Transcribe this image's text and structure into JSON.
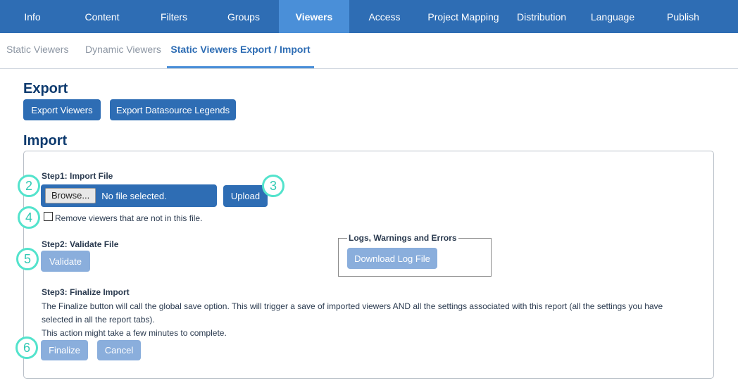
{
  "top_tabs": [
    "Info",
    "Content",
    "Filters",
    "Groups",
    "Viewers",
    "Access",
    "Project Mapping",
    "Distribution",
    "Language",
    "Publish"
  ],
  "active_top_tab": "Viewers",
  "sub_tabs": [
    "Static Viewers",
    "Dynamic Viewers",
    "Static Viewers Export / Import"
  ],
  "active_sub_tab": "Static Viewers Export / Import",
  "export": {
    "heading": "Export",
    "export_viewers_button": "Export Viewers",
    "export_legends_button": "Export Datasource Legends"
  },
  "import": {
    "heading": "Import",
    "step1": {
      "label": "Step1: Import File",
      "browse_button": "Browse...",
      "file_status": "No file selected.",
      "upload_button": "Upload",
      "remove_checkbox_label": "Remove viewers that are not in this file.",
      "remove_checked": false
    },
    "step2": {
      "label": "Step2: Validate File",
      "validate_button": "Validate"
    },
    "logs": {
      "legend": "Logs, Warnings and Errors",
      "download_button": "Download Log File"
    },
    "step3": {
      "label": "Step3: Finalize Import",
      "description_line1": "The Finalize button will call the global save option. This will trigger a save of imported viewers AND all the settings associated with this report (all the settings you have",
      "description_line2": "selected in all the report tabs).",
      "description_line3": "This action might take a few minutes to complete.",
      "finalize_button": "Finalize",
      "cancel_button": "Cancel"
    }
  },
  "markers": [
    "2",
    "3",
    "4",
    "5",
    "6"
  ],
  "colors": {
    "nav_bg": "#2e6db4",
    "nav_active": "#4a8fd8",
    "heading": "#0d3a6e",
    "marker": "#53e3cc"
  }
}
